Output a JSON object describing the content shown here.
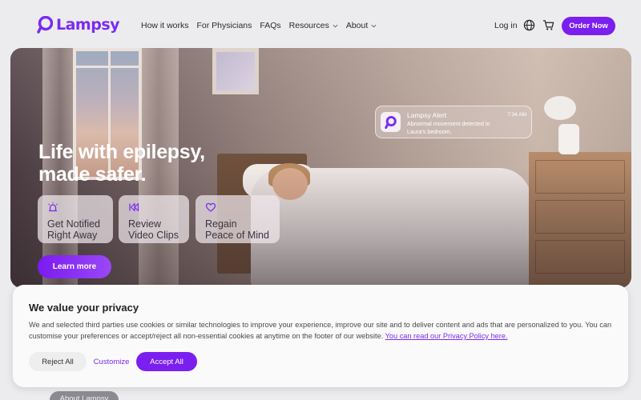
{
  "brand": {
    "name": "Lampsy",
    "accent": "#7b1ff0"
  },
  "nav": {
    "items": [
      {
        "label": "How it works",
        "dropdown": false
      },
      {
        "label": "For Physicians",
        "dropdown": false
      },
      {
        "label": "FAQs",
        "dropdown": false
      },
      {
        "label": "Resources",
        "dropdown": true
      },
      {
        "label": "About",
        "dropdown": true
      }
    ],
    "login": "Log in",
    "globe_icon": "globe-icon",
    "cart_icon": "cart-icon",
    "order": "Order Now"
  },
  "hero": {
    "headline_line1": "Life with epilepsy,",
    "headline_line2": "made safer.",
    "alert": {
      "title": "Lampsy Alert",
      "time": "7:34 AM",
      "message": "Abnormal movement detected in Laura's bedroom."
    },
    "features": [
      {
        "icon": "siren-icon",
        "text": "Get Notified\nRight Away"
      },
      {
        "icon": "rewind-icon",
        "text": "Review\nVideo Clips"
      },
      {
        "icon": "heart-icon",
        "text": "Regain\nPeace of Mind"
      }
    ],
    "cta": "Learn more"
  },
  "cookie": {
    "title": "We value your privacy",
    "text": "We and selected third parties use cookies or similar technologies to improve your experience, improve our site and to deliver content and ads that are personalized to you. You can customise your preferences or accept/reject all non-essential cookies at anytime on the footer of our website.",
    "link": "You can read our Privacy Policy here.",
    "reject": "Reject All",
    "customize": "Customize",
    "accept": "Accept All"
  },
  "footer_pill": "About Lampsy"
}
